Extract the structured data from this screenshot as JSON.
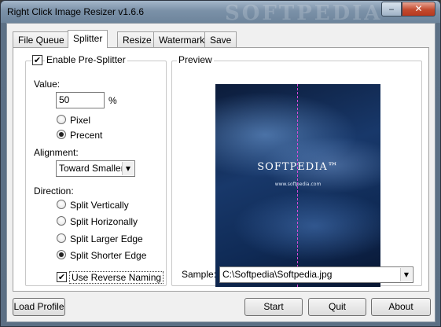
{
  "window": {
    "title": "Right Click Image Resizer v1.6.6",
    "watermark": "SOFTPEDIA",
    "minimize_glyph": "‒",
    "close_glyph": "✕"
  },
  "tabs": [
    {
      "label": "File Queue",
      "active": false
    },
    {
      "label": "Splitter",
      "active": true
    },
    {
      "label": "Resize",
      "active": false
    },
    {
      "label": "Watermark",
      "active": false
    },
    {
      "label": "Save",
      "active": false
    }
  ],
  "splitter": {
    "enable_label": "Enable Pre-Splitter",
    "enable_checked": true,
    "value_label": "Value:",
    "value": "50",
    "percent_sign": "%",
    "unit_options": [
      {
        "label": "Pixel",
        "selected": false
      },
      {
        "label": "Precent",
        "selected": true
      }
    ],
    "alignment_label": "Alignment:",
    "alignment_value": "Toward Smaller V",
    "direction_label": "Direction:",
    "direction_options": [
      {
        "label": "Split Vertically",
        "selected": false
      },
      {
        "label": "Split Horizonally",
        "selected": false
      },
      {
        "label": "Split Larger Edge",
        "selected": false
      },
      {
        "label": "Split Shorter Edge",
        "selected": true
      }
    ],
    "reverse_label": "Use Reverse Naming",
    "reverse_checked": true
  },
  "preview": {
    "caption": "Preview",
    "image_logo_text": "SOFTPEDIA™",
    "image_url_text": "www.softpedia.com",
    "sample_label": "Sample:",
    "sample_value": "C:\\Softpedia\\Softpedia.jpg",
    "split_line_color": "#d94ad9"
  },
  "footer": {
    "load_profile": "Load Profile",
    "start": "Start",
    "quit": "Quit",
    "about": "About"
  },
  "icons": {
    "check": "✔",
    "dropdown": "▼"
  }
}
